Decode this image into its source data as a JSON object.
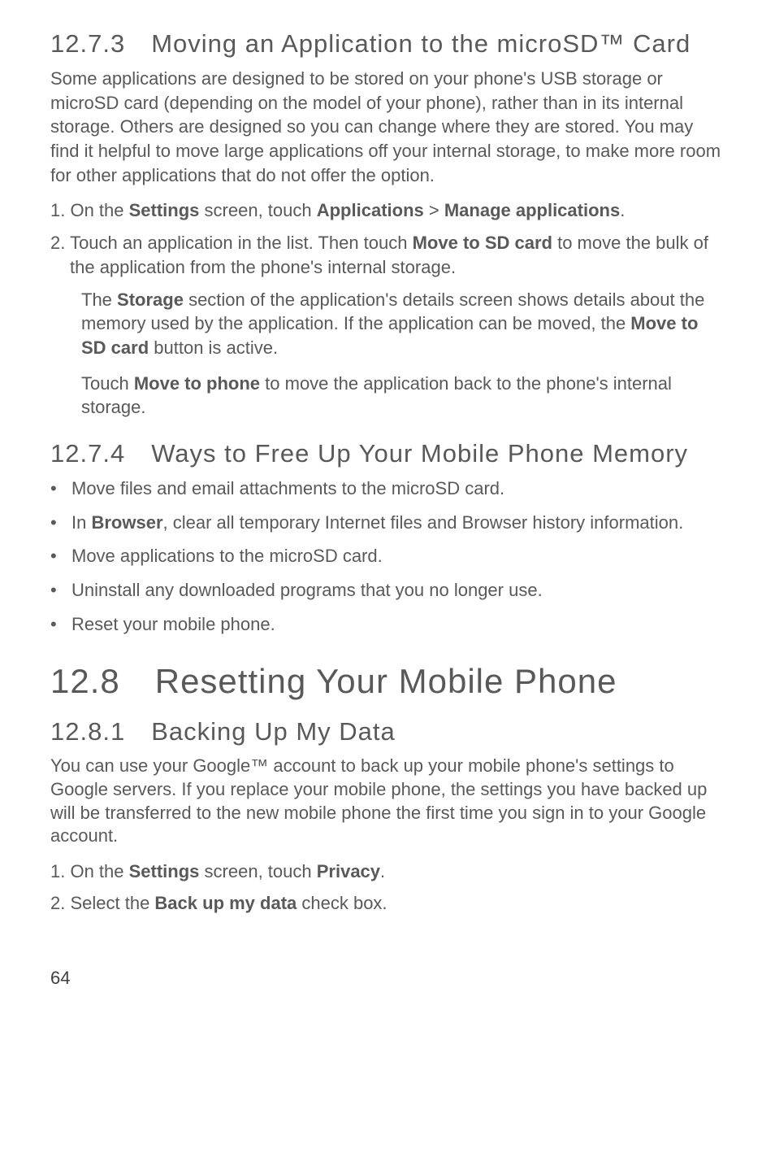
{
  "section1": {
    "heading": "12.7.3 Moving an Application to the microSD™ Card",
    "para1": "Some applications are designed to be stored on your phone's USB storage or microSD card (depending on the model of your phone), rather than in its internal storage. Others are designed so you can change where they are stored. You may find it helpful to move large applications off your internal storage, to make more room for other applications that  do not offer the option.",
    "step1_prefix": "1. On the ",
    "b_settings": "Settings",
    "step1_mid": " screen, touch ",
    "b_applications": "Applications",
    "gt": " > ",
    "b_manage": "Manage applications",
    "period": ".",
    "step2_prefix": "2. Touch an application in the list. Then touch ",
    "b_move_sd": "Move to SD card",
    "step2_suffix": " to move the bulk of the application from the phone's internal storage.",
    "sub1_prefix": "The ",
    "b_storage": "Storage",
    "sub1_mid": " section of the application's details screen shows details about the memory used by the application. If the application can be moved, the ",
    "b_move_sd2": "Move to SD card",
    "sub1_suffix": " button is active.",
    "sub2_prefix": "Touch ",
    "b_move_phone": "Move to phone",
    "sub2_suffix": " to move the application back to the phone's internal storage."
  },
  "section2": {
    "heading": "12.7.4 Ways to Free Up Your Mobile Phone Memory",
    "bullets": {
      "b1": "Move files and email attachments to the microSD card.",
      "b2_prefix": "In ",
      "b2_bold": "Browser",
      "b2_suffix": ", clear all temporary Internet files and Browser history information.",
      "b3": "Move applications to the microSD card.",
      "b4": "Uninstall any downloaded programs that you no longer use.",
      "b5": "Reset your mobile phone."
    }
  },
  "section3": {
    "heading": "12.8 Resetting Your Mobile Phone"
  },
  "section4": {
    "heading": "12.8.1 Backing Up My Data",
    "para": "You can use your Google™ account to back up your mobile phone's settings to Google servers. If you replace your mobile phone, the settings you have backed up will be transferred to the new mobile phone the first time you sign in to your Google account.",
    "step1_prefix": "1. On the ",
    "b_settings": "Settings",
    "step1_mid": " screen, touch ",
    "b_privacy": "Privacy",
    "period": ".",
    "step2_prefix": "2. Select the ",
    "b_backup": "Back up my data",
    "step2_suffix": " check box."
  },
  "footer": {
    "page": "64"
  },
  "glyphs": {
    "bullet": "•"
  }
}
